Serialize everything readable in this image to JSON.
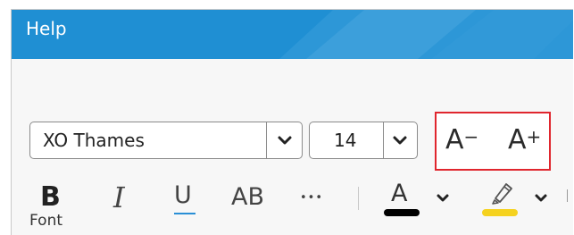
{
  "titlebar": {
    "tab": "Help",
    "color": "#1f8fd3"
  },
  "font": {
    "family_value": "XO Thames",
    "size_value": "14",
    "decrease_label": "A",
    "decrease_sign": "−",
    "increase_label": "A",
    "increase_sign": "+",
    "group_label": "Font"
  },
  "format_buttons": {
    "bold": "B",
    "italic": "I",
    "underline": "U",
    "strikethrough": "AB",
    "more": "•••",
    "font_color_letter": "A"
  },
  "colors": {
    "font_color": "#000000",
    "highlight_color": "#f5d21f",
    "highlight_box_border": "#e0262e",
    "underline_accent": "#2a8fd6"
  },
  "icons": [
    "chevron-down-icon",
    "bold-icon",
    "italic-icon",
    "underline-icon",
    "strikethrough-icon",
    "more-icon",
    "font-color-icon",
    "highlighter-icon"
  ]
}
